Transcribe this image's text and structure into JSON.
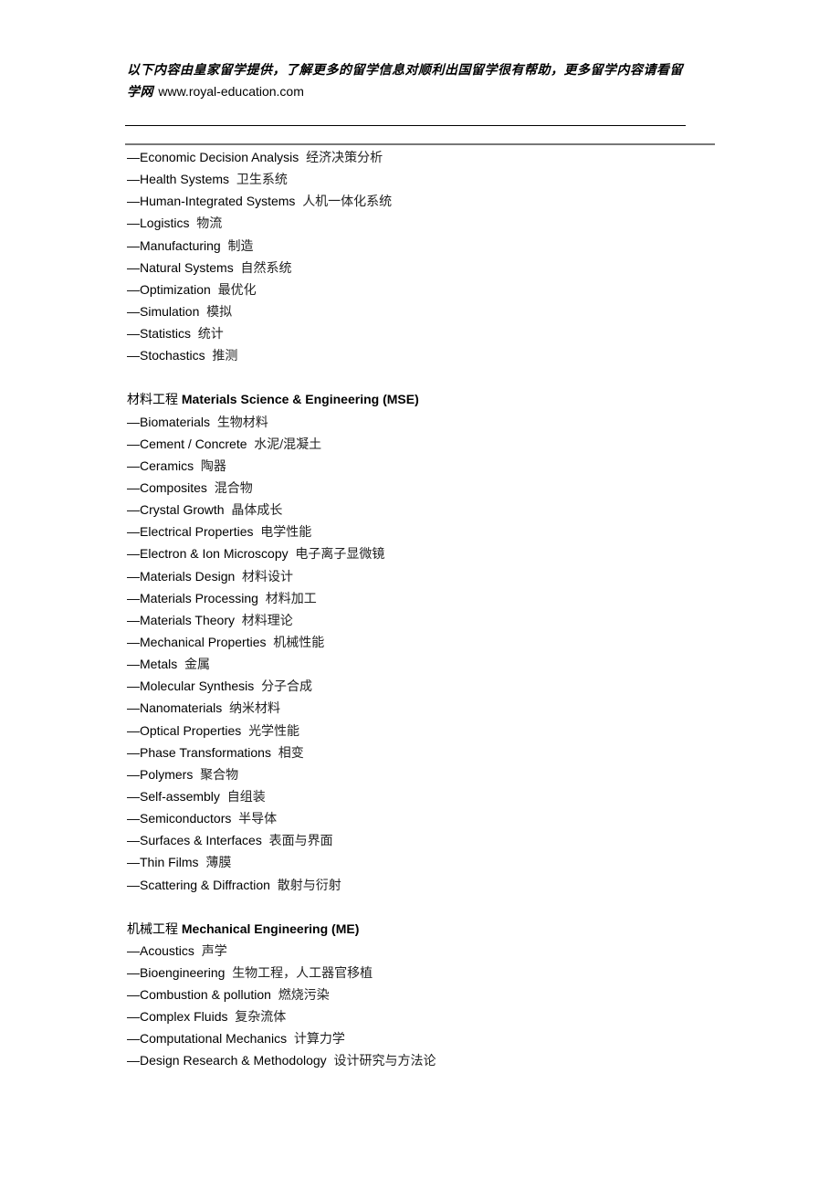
{
  "header": {
    "text": "以下内容由皇家留学提供，了解更多的留学信息对顺利出国留学很有帮助，更多留学内容请看留学网",
    "url": "www.royal-education.com"
  },
  "sections": [
    {
      "heading": null,
      "items": [
        {
          "en": "—Economic Decision Analysis",
          "zh": "经济决策分析"
        },
        {
          "en": "—Health Systems",
          "zh": "卫生系统"
        },
        {
          "en": "—Human-Integrated Systems",
          "zh": "人机一体化系统"
        },
        {
          "en": "—Logistics",
          "zh": "物流"
        },
        {
          "en": "—Manufacturing",
          "zh": "制造"
        },
        {
          "en": "—Natural Systems",
          "zh": "自然系统"
        },
        {
          "en": "—Optimization",
          "zh": "最优化"
        },
        {
          "en": "—Simulation",
          "zh": "模拟"
        },
        {
          "en": "—Statistics",
          "zh": "统计"
        },
        {
          "en": "—Stochastics",
          "zh": "推测"
        }
      ]
    },
    {
      "heading": {
        "zh": "材料工程",
        "en": "Materials Science & Engineering (MSE)"
      },
      "items": [
        {
          "en": "—Biomaterials",
          "zh": "生物材料"
        },
        {
          "en": "—Cement / Concrete",
          "zh": "水泥/混凝土"
        },
        {
          "en": "—Ceramics",
          "zh": "陶器"
        },
        {
          "en": "—Composites",
          "zh": "混合物"
        },
        {
          "en": "—Crystal Growth",
          "zh": "晶体成长"
        },
        {
          "en": "—Electrical Properties",
          "zh": "电学性能"
        },
        {
          "en": "—Electron & Ion Microscopy",
          "zh": "电子离子显微镜"
        },
        {
          "en": "—Materials Design",
          "zh": "材料设计"
        },
        {
          "en": "—Materials Processing",
          "zh": "材料加工"
        },
        {
          "en": "—Materials Theory",
          "zh": "材料理论"
        },
        {
          "en": "—Mechanical Properties",
          "zh": "机械性能"
        },
        {
          "en": "—Metals",
          "zh": "金属"
        },
        {
          "en": "—Molecular Synthesis",
          "zh": "分子合成"
        },
        {
          "en": "—Nanomaterials",
          "zh": "纳米材料"
        },
        {
          "en": "—Optical Properties",
          "zh": "光学性能"
        },
        {
          "en": "—Phase Transformations",
          "zh": "相变"
        },
        {
          "en": "—Polymers",
          "zh": "聚合物"
        },
        {
          "en": "—Self-assembly",
          "zh": "自组装"
        },
        {
          "en": "—Semiconductors",
          "zh": "半导体"
        },
        {
          "en": "—Surfaces & Interfaces",
          "zh": "表面与界面"
        },
        {
          "en": "—Thin Films",
          "zh": "薄膜"
        },
        {
          "en": "—Scattering & Diffraction",
          "zh": "散射与衍射"
        }
      ]
    },
    {
      "heading": {
        "zh": "机械工程",
        "en": "Mechanical Engineering (ME)"
      },
      "items": [
        {
          "en": "—Acoustics",
          "zh": "声学"
        },
        {
          "en": "—Bioengineering",
          "zh": "生物工程，人工器官移植"
        },
        {
          "en": "—Combustion & pollution",
          "zh": "燃烧污染"
        },
        {
          "en": "—Complex Fluids",
          "zh": "复杂流体"
        },
        {
          "en": "—Computational Mechanics",
          "zh": "计算力学"
        },
        {
          "en": "—Design Research & Methodology",
          "zh": "设计研究与方法论"
        }
      ]
    }
  ]
}
